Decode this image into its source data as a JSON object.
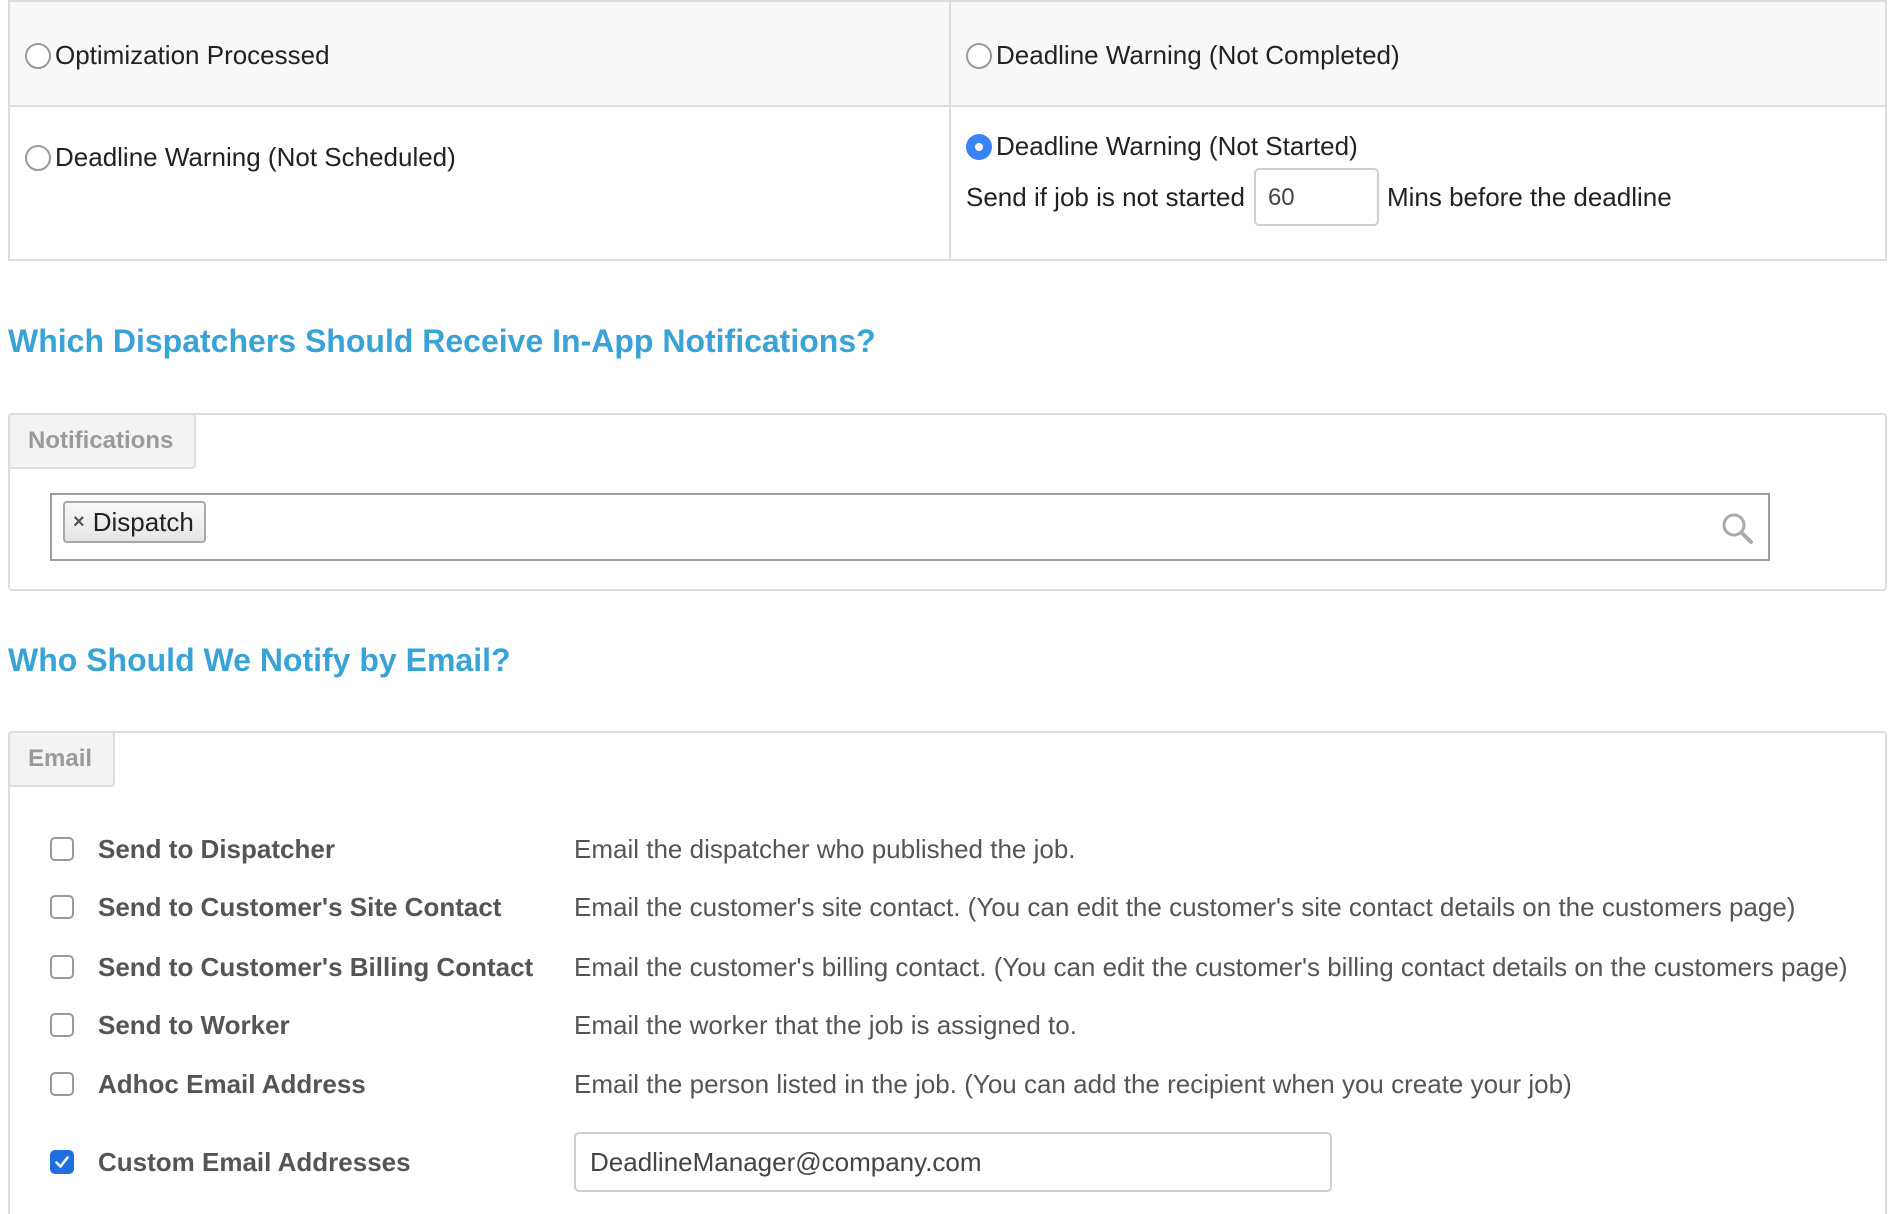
{
  "triggers": {
    "optimization_processed": "Optimization Processed",
    "deadline_not_completed": "Deadline Warning (Not Completed)",
    "deadline_not_scheduled": "Deadline Warning (Not Scheduled)",
    "deadline_not_started": "Deadline Warning (Not Started)",
    "selected": "deadline_not_started",
    "send_if_prefix": "Send if job is not started",
    "minutes_value": "60",
    "send_if_suffix": "Mins before the deadline"
  },
  "in_app": {
    "heading": "Which Dispatchers Should Receive In-App Notifications?",
    "tab_label": "Notifications",
    "tags": [
      "Dispatch"
    ],
    "tag_remove_glyph": "×"
  },
  "email": {
    "heading": "Who Should We Notify by Email?",
    "tab_label": "Email",
    "options": [
      {
        "label": "Send to Dispatcher",
        "description": "Email the dispatcher who published the job.",
        "checked": false
      },
      {
        "label": "Send to Customer's Site Contact",
        "description": "Email the customer's site contact. (You can edit the customer's site contact details on the customers page)",
        "checked": false
      },
      {
        "label": "Send to Customer's Billing Contact",
        "description": "Email the customer's billing contact. (You can edit the customer's billing contact details on the customers page)",
        "checked": false
      },
      {
        "label": "Send to Worker",
        "description": "Email the worker that the job is assigned to.",
        "checked": false
      },
      {
        "label": "Adhoc Email Address",
        "description": "Email the person listed in the job. (You can add the recipient when you create your job)",
        "checked": false
      },
      {
        "label": "Custom Email Addresses",
        "value": "DeadlineManager@company.com",
        "checked": true
      }
    ]
  },
  "colors": {
    "accent_heading": "#3aa3d6",
    "radio_selected": "#3b82f6",
    "checkbox_checked": "#1f6fe0"
  },
  "icons": {
    "search": "search-icon",
    "tag_remove": "close-icon",
    "check": "check-icon"
  }
}
